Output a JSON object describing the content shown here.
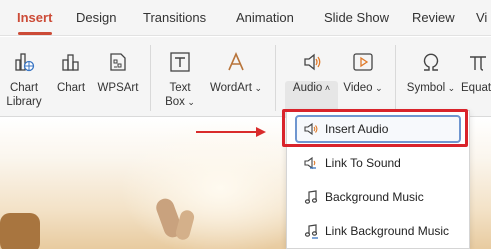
{
  "tabs": [
    {
      "label": "Insert",
      "active": true
    },
    {
      "label": "Design"
    },
    {
      "label": "Transitions"
    },
    {
      "label": "Animation"
    },
    {
      "label": "Slide Show"
    },
    {
      "label": "Review"
    },
    {
      "label": "Vi"
    }
  ],
  "ribbon": {
    "chart_library": {
      "line1": "Chart",
      "line2": "Library"
    },
    "chart": "Chart",
    "wpsart": "WPSArt",
    "text_box": {
      "line1": "Text",
      "line2": "Box"
    },
    "wordart": "WordArt",
    "audio": "Audio",
    "video": "Video",
    "symbol": "Symbol",
    "equation": "Equatio"
  },
  "audio_menu": {
    "items": [
      {
        "label": "Insert Audio",
        "icon": "speaker-icon",
        "selected": true
      },
      {
        "label": "Link To Sound",
        "icon": "link-speaker-icon"
      },
      {
        "label": "Background Music",
        "icon": "music-note-icon"
      },
      {
        "label": "Link Background Music",
        "icon": "link-music-icon"
      }
    ]
  },
  "colors": {
    "accent": "#cc4b37",
    "annotation_red": "#d9232b",
    "selection_blue": "#6f96d0"
  }
}
